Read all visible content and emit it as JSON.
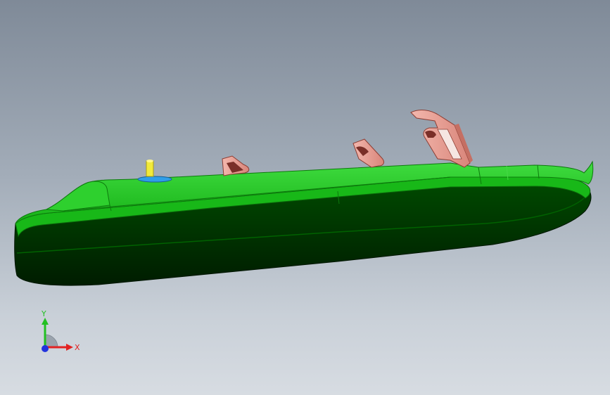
{
  "viewport": {
    "background_top": "#7f8a98",
    "background_bottom": "#d7dce2"
  },
  "model": {
    "body_color": "#1fc21f",
    "body_highlight": "#4be04b",
    "underside_color": "#002a00",
    "bracket_color": "#e9a49a",
    "pin_color": "#f2ea3a",
    "pad_color": "#2f9ee8"
  },
  "triad": {
    "x_label": "X",
    "y_label": "Y",
    "x_color": "#e22222",
    "y_color": "#22c022",
    "z_color": "#2233dd"
  }
}
